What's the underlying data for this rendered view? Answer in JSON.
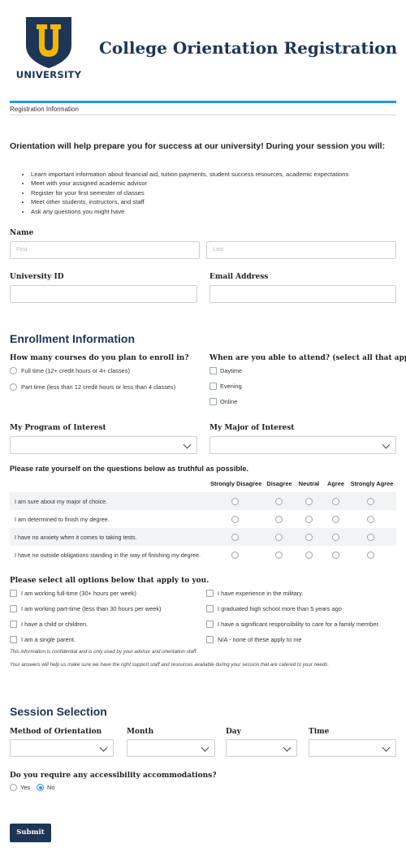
{
  "header": {
    "logo_letter": "U",
    "logo_text": "UNIVERSITY",
    "title": "College Orientation Registration",
    "section_tab": "Registration Information"
  },
  "intro": {
    "heading": "Orientation will help prepare you for success at our university! During your session you will:",
    "bullets": [
      "Learn important information about financial aid, tuition payments, student success resources, academic expectations",
      "Meet with your assigned academic advisor",
      "Register for your first semester of classes",
      "Meet other students, instructors, and staff",
      "Ask any questions you might have"
    ]
  },
  "name": {
    "label": "Name",
    "first_placeholder": "First",
    "last_placeholder": "Last"
  },
  "university_id": {
    "label": "University ID",
    "value": ""
  },
  "email": {
    "label": "Email Address",
    "value": ""
  },
  "enrollment": {
    "heading": "Enrollment Information",
    "courses_question": "How many courses do you plan to enroll in?",
    "courses_options": [
      "Full time (12+ credit hours or 4+ classes)",
      "Part time (less than 12 credit hours or less than 4 classes)"
    ],
    "attend_question": "When are you able to attend? (select all that apply)",
    "attend_options": [
      "Daytime",
      "Evening",
      "Online"
    ],
    "program_label": "My Program of Interest",
    "major_label": "My Major of Interest"
  },
  "rating": {
    "heading": "Please rate yourself on the questions below as truthful as possible.",
    "columns": [
      "Strongly Disagree",
      "Disagree",
      "Neutral",
      "Agree",
      "Strongly Agree"
    ],
    "rows": [
      "I am sure about my major of choice.",
      "I am determined to finish my degree.",
      "I have no anxiety when it comes to taking tests.",
      "I have no outside obligations standing in the way of finishing my degree."
    ]
  },
  "apply": {
    "heading": "Please select all options below that apply to you.",
    "left": [
      "I am working full-time (30+ hours per week)",
      "I am working part-time (less than 30 hours per week)",
      "I have a child or children.",
      "I am a single parent."
    ],
    "right": [
      "I have experience in the military.",
      "I graduated high school more than 5 years ago",
      "I have a significant responsibility to care for a family member.",
      "N/A - none of these apply to me"
    ],
    "note1": "This information is confidential and is only used by your advisor and orientation staff.",
    "note2": "Your answers will help us make sure we have the right support staff and resources available during your session that are catered to your needs."
  },
  "session": {
    "heading": "Session Selection",
    "method_label": "Method of Orientation",
    "month_label": "Month",
    "day_label": "Day",
    "time_label": "Time",
    "access_question": "Do you require any accessibility accommodations?",
    "access_options": [
      "Yes",
      "No"
    ],
    "access_selected": "No"
  },
  "submit_label": "Submit",
  "colors": {
    "navy": "#1d3557",
    "accent_blue": "#2a93e8",
    "logo_gold": "#f2b705"
  }
}
